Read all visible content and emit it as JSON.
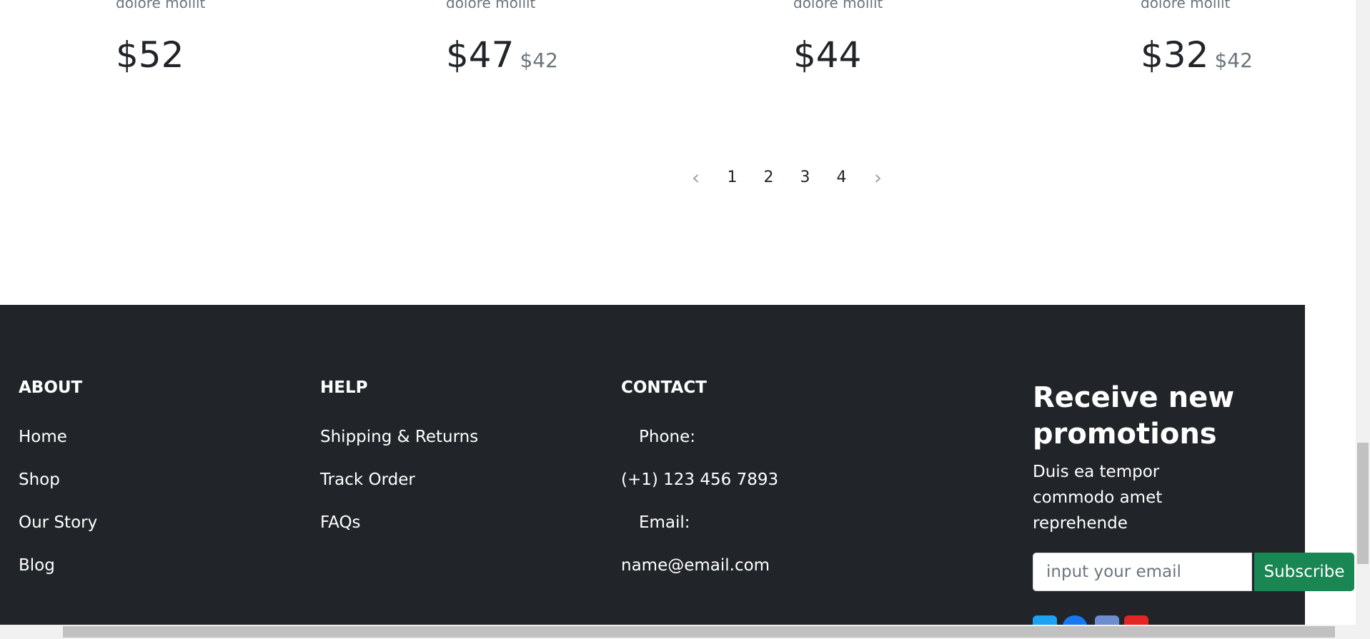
{
  "products": [
    {
      "subtitle": "dolore mollit",
      "price": "$52",
      "old_price": ""
    },
    {
      "subtitle": "dolore mollit",
      "price": "$47",
      "old_price": "$42"
    },
    {
      "subtitle": "dolore mollit",
      "price": "$44",
      "old_price": ""
    },
    {
      "subtitle": "dolore mollit",
      "price": "$32",
      "old_price": "$42"
    }
  ],
  "pagination": {
    "prev_icon": "chevron-left-icon",
    "next_icon": "chevron-right-icon",
    "pages": [
      "1",
      "2",
      "3",
      "4"
    ]
  },
  "footer": {
    "about": {
      "heading": "ABOUT",
      "links": [
        "Home",
        "Shop",
        "Our Story",
        "Blog"
      ]
    },
    "help": {
      "heading": "HELP",
      "links": [
        "Shipping & Returns",
        "Track Order",
        "FAQs"
      ]
    },
    "contact": {
      "heading": "CONTACT",
      "phone_label": "Phone:",
      "phone": "(+1) 123 456 7893",
      "email_label": "Email:",
      "email": "name@email.com"
    },
    "newsletter": {
      "title": "Receive new promotions",
      "text": "Duis ea tempor commodo amet reprehende",
      "placeholder": "input your email",
      "button": "Subscribe"
    },
    "social_icons": [
      "twitter-icon",
      "facebook-icon",
      "linkedin-icon",
      "youtube-icon"
    ]
  },
  "colors": {
    "footer_bg": "#212529",
    "accent": "#198754"
  }
}
